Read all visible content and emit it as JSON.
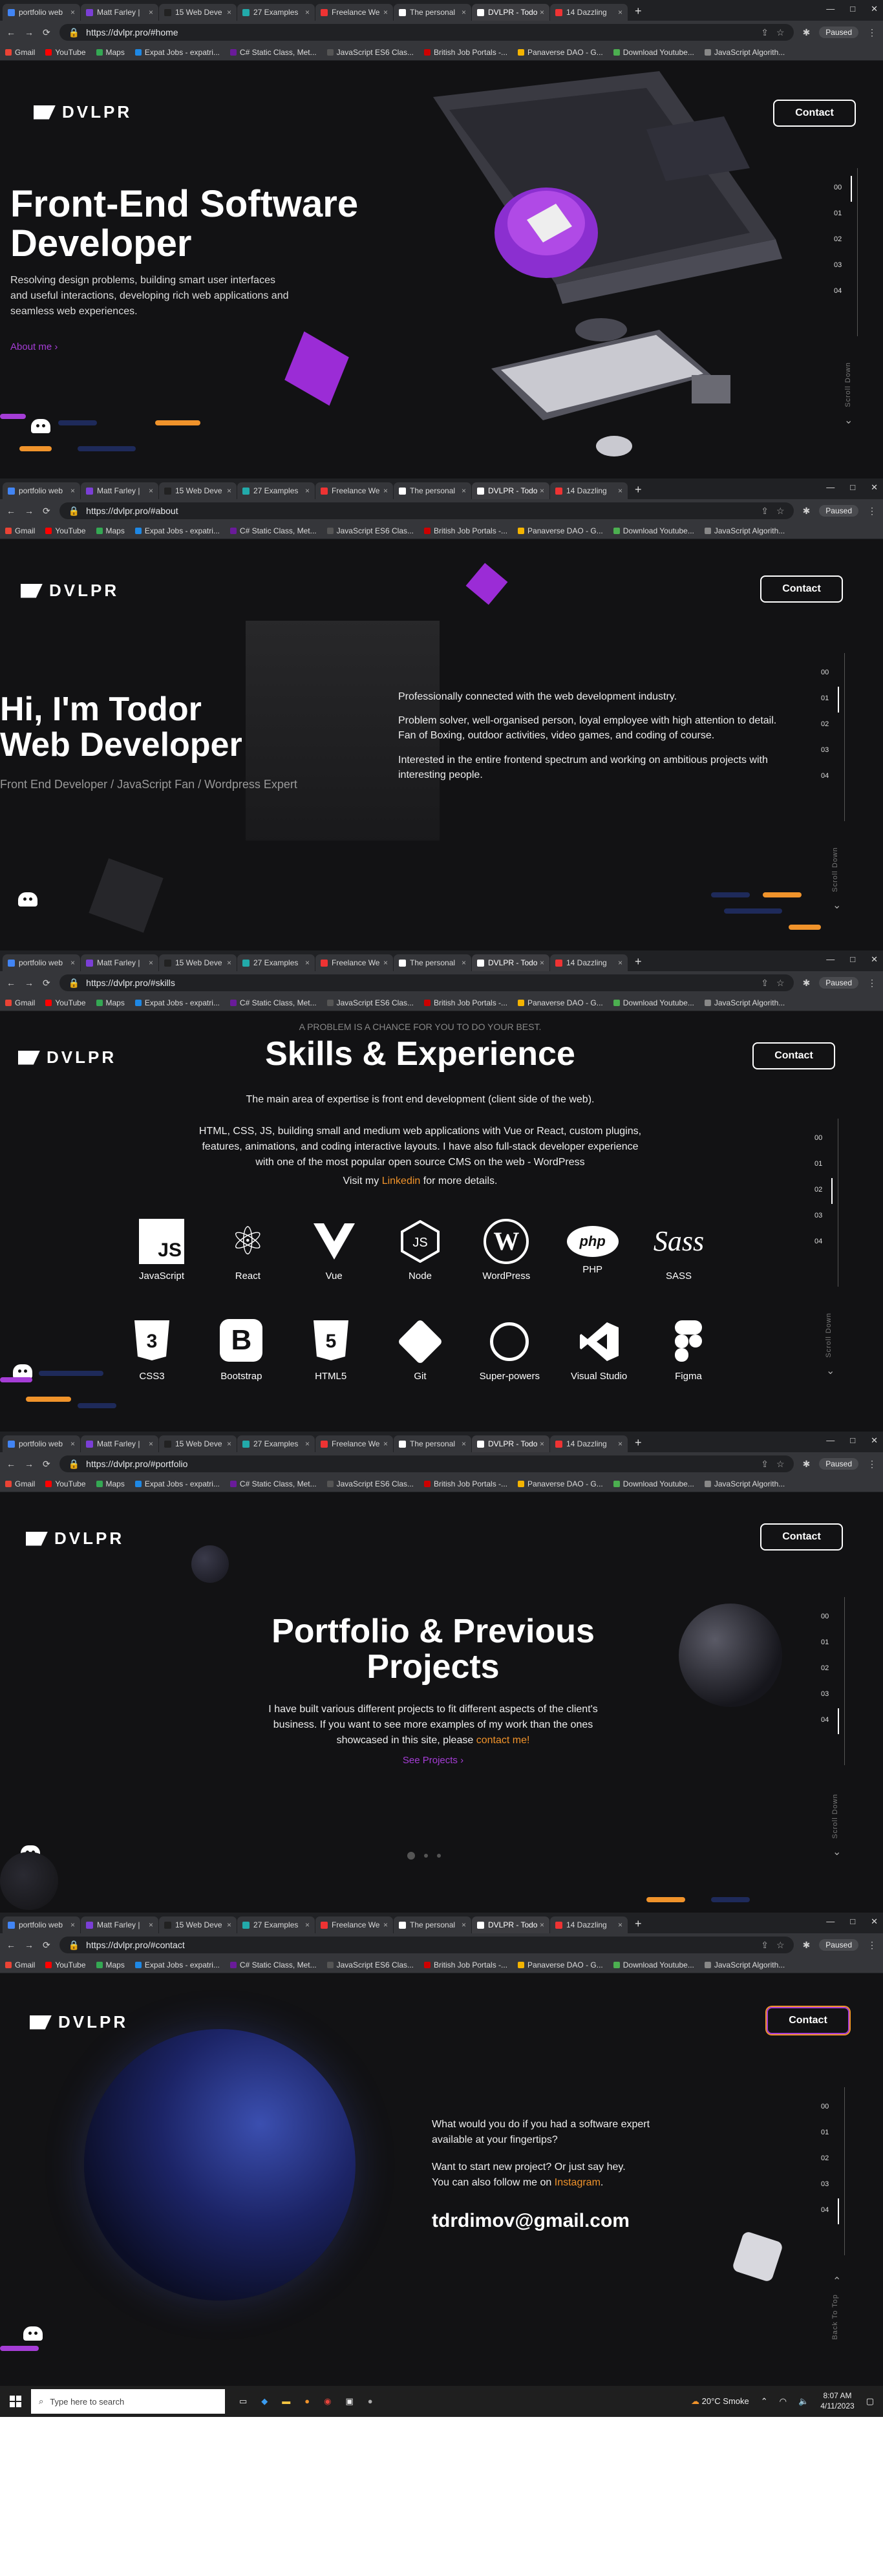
{
  "browser": {
    "tabs": [
      "portfolio web",
      "Matt Farley |",
      "15 Web Deve",
      "27 Examples",
      "Freelance We",
      "The personal",
      "DVLPR - Todo",
      "14 Dazzling"
    ],
    "tabs_full": [
      "portfolio web",
      "Matt Farley |",
      "15 Web Deve",
      "27 Examples",
      "Freelance We",
      "The personal",
      "DVLPR - Todo",
      "14 Dazzling"
    ],
    "paused": "Paused",
    "bookmarks": [
      "Gmail",
      "YouTube",
      "Maps",
      "Expat Jobs - expatri...",
      "C# Static Class, Met...",
      "JavaScript ES6 Clas...",
      "British Job Portals -...",
      "Panaverse DAO - G...",
      "Download Youtube...",
      "JavaScript Algorith..."
    ]
  },
  "urls": {
    "home": "https://dvlpr.pro/#home",
    "about": "https://dvlpr.pro/#about",
    "skills": "https://dvlpr.pro/#skills",
    "portfolio": "https://dvlpr.pro/#portfolio",
    "contact": "https://dvlpr.pro/#contact"
  },
  "site": {
    "logo": "DVLPR",
    "contact_button": "Contact",
    "nav_index": [
      "00",
      "01",
      "02",
      "03",
      "04"
    ],
    "scroll_down": "Scroll Down",
    "back_to_top": "Back To Top"
  },
  "home": {
    "title_line1": "Front-End Software",
    "title_line2": "Developer",
    "text": "Resolving design problems, building smart user interfaces and useful interactions, developing rich web applications and seamless web experiences.",
    "link": "About me"
  },
  "about": {
    "title_line1": "Hi, I'm Todor",
    "title_line2": "Web Developer",
    "subtitle": "Front End Developer / JavaScript Fan / Wordpress Expert",
    "p1": "Professionally connected with the web development industry.",
    "p2": "Problem solver, well-organised person, loyal employee with high attention to detail.",
    "p3": "Fan of Boxing, outdoor activities, video games, and coding of course.",
    "p4": "Interested in the entire frontend spectrum and working on ambitious projects with interesting people."
  },
  "skills": {
    "kicker": "A PROBLEM IS A CHANCE FOR YOU TO DO YOUR BEST.",
    "title": "Skills & Experience",
    "p1": "The main area of expertise is front end development (client side of the web).",
    "p2": "HTML, CSS, JS, building small and medium web applications with Vue or React, custom plugins, features, animations, and coding interactive layouts. I have also full-stack developer experience with one of the most popular open source CMS on the web - WordPress",
    "visit_pre": "Visit my ",
    "visit_link": "Linkedin",
    "visit_post": " for more details.",
    "row1": [
      "JavaScript",
      "React",
      "Vue",
      "Node",
      "WordPress",
      "PHP",
      "SASS"
    ],
    "row2": [
      "CSS3",
      "Bootstrap",
      "HTML5",
      "Git",
      "Super-powers",
      "Visual Studio",
      "Figma"
    ]
  },
  "portfolio": {
    "title_line1": "Portfolio & Previous",
    "title_line2": "Projects",
    "text_pre": "I have built various different projects to fit different aspects of the client's business. If you want to see more examples of my work than the ones showcased in this site, please ",
    "text_link": "contact me!",
    "link": "See Projects"
  },
  "contact": {
    "q": "What would you do if you had a software expert available at your fingertips?",
    "p_pre": "Want to start new project? Or just say hey. You can also follow me on ",
    "p_link": "Instagram",
    "p_post": ".",
    "email": "tdrdimov@gmail.com"
  },
  "taskbar": {
    "search": "Type here to search",
    "weather": "20°C  Smoke",
    "time": "8:07 AM",
    "date": "4/11/2023"
  },
  "colors": {
    "accent_purple": "#a53dd6",
    "accent_orange": "#f0932b",
    "bg": "#121214"
  }
}
